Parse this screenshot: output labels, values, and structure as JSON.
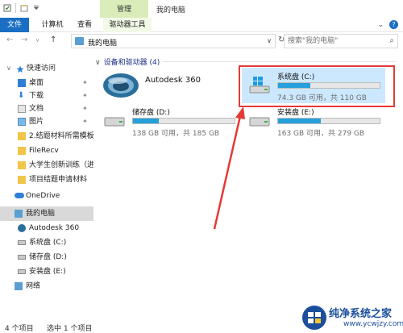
{
  "window": {
    "context_tab": "管理",
    "title": "我的电脑"
  },
  "ribbon": {
    "tabs": [
      "文件",
      "计算机",
      "查看",
      "驱动器工具"
    ],
    "expand_icon": "chevron-down-icon",
    "help_icon": "help-icon"
  },
  "address": {
    "path": "我的电脑",
    "search_placeholder": "搜索\"我的电脑\""
  },
  "nav": {
    "items": [
      {
        "label": "快速访问",
        "icon": "star-icon"
      },
      {
        "label": "桌面",
        "icon": "desktop-icon"
      },
      {
        "label": "下载",
        "icon": "download-icon"
      },
      {
        "label": "文档",
        "icon": "document-icon"
      },
      {
        "label": "图片",
        "icon": "picture-icon"
      },
      {
        "label": "2.结题材料所需模板",
        "icon": "folder-icon"
      },
      {
        "label": "FileRecv",
        "icon": "folder-icon"
      },
      {
        "label": "大学生创新训练（进",
        "icon": "folder-icon"
      },
      {
        "label": "项目结题申请材料",
        "icon": "folder-icon"
      },
      {
        "label": "OneDrive",
        "icon": "cloud-icon"
      },
      {
        "label": "我的电脑",
        "icon": "computer-icon"
      },
      {
        "label": "Autodesk 360",
        "icon": "autodesk-icon"
      },
      {
        "label": "系统盘 (C:)",
        "icon": "drive-icon"
      },
      {
        "label": "储存盘 (D:)",
        "icon": "drive-icon"
      },
      {
        "label": "安装盘 (E:)",
        "icon": "drive-icon"
      },
      {
        "label": "网络",
        "icon": "network-icon"
      }
    ]
  },
  "content": {
    "group_header": "设备和驱动器 (4)",
    "autodesk": {
      "name": "Autodesk 360"
    },
    "drives": [
      {
        "name": "系统盘 (C:)",
        "info": "74.3 GB 可用，共 110 GB",
        "used_fraction": 0.32,
        "bar_color": "#26a0da"
      },
      {
        "name": "储存盘 (D:)",
        "info": "138 GB 可用，共 185 GB",
        "used_fraction": 0.25,
        "bar_color": "#26a0da"
      },
      {
        "name": "安装盘 (E:)",
        "info": "163 GB 可用，共 279 GB",
        "used_fraction": 0.42,
        "bar_color": "#26a0da"
      }
    ]
  },
  "status": {
    "item_count": "4 个项目",
    "selected": "选中 1 个项目"
  },
  "watermark": {
    "text": "纯净系统之家",
    "url": "www.ycwjzy.com"
  },
  "colors": {
    "accent": "#1a6fc4",
    "selection": "#cce8ff",
    "annotation": "#e53935"
  }
}
